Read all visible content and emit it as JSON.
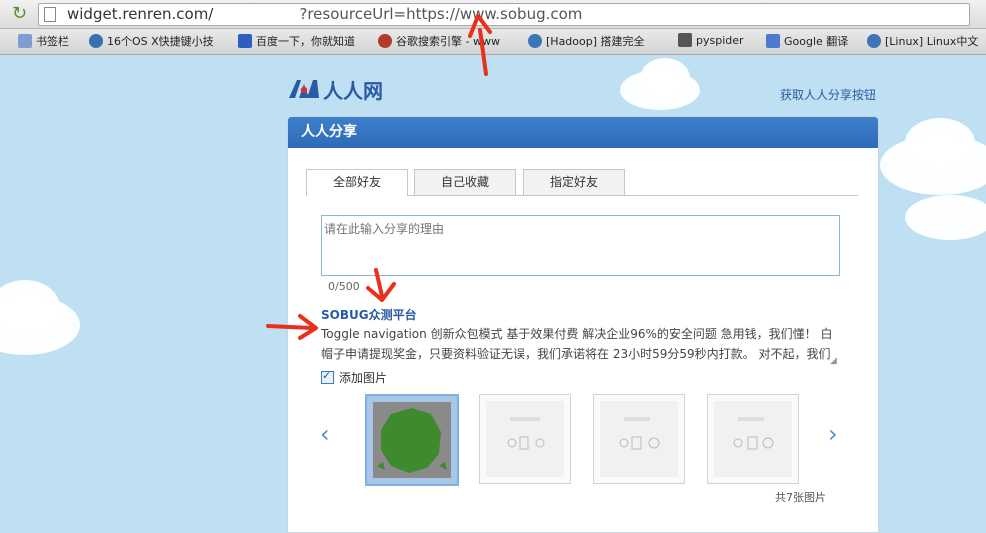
{
  "browser": {
    "url_host": "widget.renren.com/",
    "url_query": "?resourceUrl=https://www.sobug.com"
  },
  "bookmarks": [
    {
      "label": "书签栏",
      "icon": "folder-icon",
      "color": "#6d8fbf"
    },
    {
      "label": "16个OS X快捷键小技",
      "icon": "m-logo-icon",
      "color": "#3a6fb0"
    },
    {
      "label": "百度一下，你就知道",
      "icon": "paw-icon",
      "color": "#2b5fc2"
    },
    {
      "label": "谷歌搜索引擎 - www",
      "icon": "bug-icon",
      "color": "#b23b2b"
    },
    {
      "label": "[Hadoop] 搭建完全",
      "icon": "globe-icon",
      "color": "#3b74b8"
    },
    {
      "label": "pyspider",
      "icon": "grid-icon",
      "color": "#555555"
    },
    {
      "label": "Google 翻译",
      "icon": "translate-icon",
      "color": "#4a7bd0"
    },
    {
      "label": "[Linux] Linux中文",
      "icon": "globe-icon",
      "color": "#3b74b8"
    }
  ],
  "header": {
    "logo_text": "人人网",
    "get_button_link": "获取人人分享按钮"
  },
  "panel": {
    "title": "人人分享",
    "tabs": [
      "全部好友",
      "自己收藏",
      "指定好友"
    ],
    "reason_placeholder": "请在此输入分享的理由",
    "counter": "0/500",
    "share_title": "SOBUG众测平台",
    "share_desc": "Toggle navigation  创新众包模式  基于效果付费 解决企业96%的安全问题 急用钱，我们懂！ 白帽子申请提现奖金，只要资料验证无误，我们承诺将在 23小时59分59秒内打款。 对不起，我们",
    "add_image_label": "添加图片",
    "image_count": "共7张图片"
  },
  "colors": {
    "accent": "#2f6bb6",
    "link": "#2a5aa5",
    "annotation": "#e8301c"
  }
}
